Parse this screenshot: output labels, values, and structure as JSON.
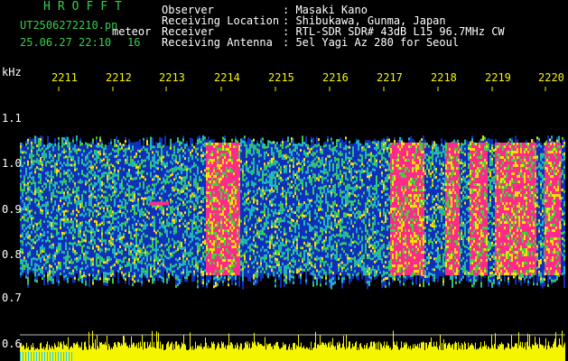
{
  "header": {
    "app_title": "HROFFT",
    "filename": "UT2506272210.pn",
    "mode": "meteor",
    "datetime": "25.06.27 22:10",
    "count": "16"
  },
  "info": {
    "observer_key": "Observer",
    "observer_val": ": Masaki Kano",
    "location_key": "Receiving Location",
    "location_val": ": Shibukawa, Gunma, Japan",
    "receiver_key": "Receiver",
    "receiver_val": ": RTL-SDR SDR# 43dB L15 96.7MHz CW",
    "antenna_key": "Receiving Antenna",
    "antenna_val": ": 5el Yagi Az 280 for Seoul"
  },
  "axis": {
    "unit": "kHz",
    "freq_ticks": [
      "1.1",
      "1.0",
      "0.9",
      "0.8",
      "0.7",
      "0.6"
    ],
    "time_ticks": [
      "2211",
      "2212",
      "2213",
      "2214",
      "2215",
      "2216",
      "2217",
      "2218",
      "2219",
      "2220"
    ]
  },
  "colors": {
    "background": "#000000",
    "title_green": "#35d04a",
    "tick_yellow": "#f5f500",
    "low_band": "#1030c0",
    "mid_band": "#20b8c0",
    "high_band": "#40d040",
    "peak": "#ff2a8a",
    "level_bar": "#f5f500"
  },
  "chart_data": {
    "type": "heatmap",
    "xlabel": "",
    "ylabel": "kHz",
    "x_ticks": [
      "2211",
      "2212",
      "2213",
      "2214",
      "2215",
      "2216",
      "2217",
      "2218",
      "2219",
      "2220"
    ],
    "y_ticks": [
      1.1,
      1.0,
      0.9,
      0.8,
      0.7,
      0.6
    ],
    "ylim": [
      0.58,
      1.17
    ],
    "signal_band_khz": [
      0.75,
      1.05
    ],
    "intense_minutes": [
      "2214",
      "2217",
      "2218",
      "2219"
    ]
  }
}
